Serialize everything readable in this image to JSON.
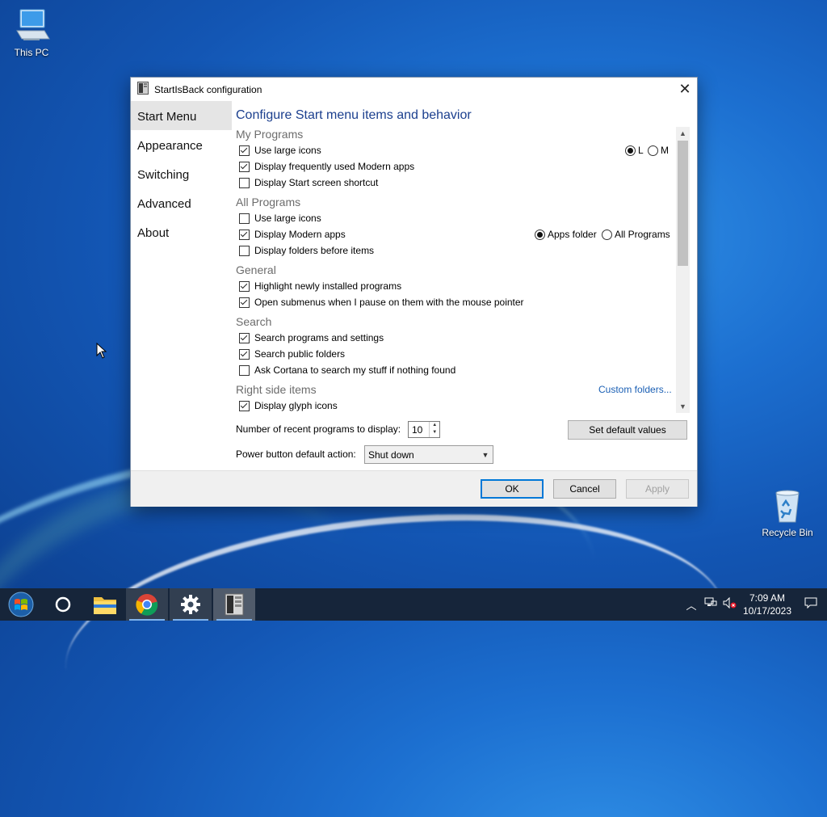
{
  "desktop": {
    "this_pc_label": "This PC",
    "recycle_bin_label": "Recycle Bin"
  },
  "dialog": {
    "title": "StartIsBack configuration",
    "nav": [
      "Start Menu",
      "Appearance",
      "Switching",
      "Advanced",
      "About"
    ],
    "active_nav": "Start Menu",
    "page_title": "Configure Start menu items and behavior",
    "sections": {
      "my_programs": {
        "heading": "My Programs",
        "items": [
          {
            "label": "Use large icons",
            "checked": true
          },
          {
            "label": "Display frequently used Modern apps",
            "checked": true
          },
          {
            "label": "Display Start screen shortcut",
            "checked": false
          }
        ],
        "size_options": [
          {
            "label": "L",
            "selected": true
          },
          {
            "label": "M",
            "selected": false
          }
        ]
      },
      "all_programs": {
        "heading": "All Programs",
        "items": [
          {
            "label": "Use large icons",
            "checked": false
          },
          {
            "label": "Display Modern apps",
            "checked": true
          },
          {
            "label": "Display folders before items",
            "checked": false
          }
        ],
        "modern_options": [
          {
            "label": "Apps folder",
            "selected": true
          },
          {
            "label": "All Programs",
            "selected": false
          }
        ]
      },
      "general": {
        "heading": "General",
        "items": [
          {
            "label": "Highlight newly installed programs",
            "checked": true
          },
          {
            "label": "Open submenus when I pause on them with the mouse pointer",
            "checked": true
          }
        ]
      },
      "search": {
        "heading": "Search",
        "items": [
          {
            "label": "Search programs and settings",
            "checked": true
          },
          {
            "label": "Search public folders",
            "checked": true
          },
          {
            "label": "Ask Cortana to search my stuff if nothing found",
            "checked": false
          }
        ]
      },
      "right_side": {
        "heading": "Right side items",
        "custom_folders_link": "Custom folders...",
        "items": [
          {
            "label": "Display glyph icons",
            "checked": true
          }
        ]
      }
    },
    "recent_programs": {
      "label": "Number of recent programs to display:",
      "value": "10"
    },
    "set_default_label": "Set default values",
    "power_button": {
      "label": "Power button default action:",
      "value": "Shut down"
    },
    "buttons": {
      "ok": "OK",
      "cancel": "Cancel",
      "apply": "Apply"
    }
  },
  "taskbar": {
    "apps": [
      "start-icon",
      "cortana-icon",
      "file-explorer-icon",
      "chrome-icon",
      "settings-icon",
      "startisback-config-icon"
    ],
    "clock": {
      "time": "7:09 AM",
      "date": "10/17/2023"
    }
  },
  "colors": {
    "accent": "#1b3f8e",
    "link": "#1a5fb4",
    "ok_border": "#0078d7"
  }
}
